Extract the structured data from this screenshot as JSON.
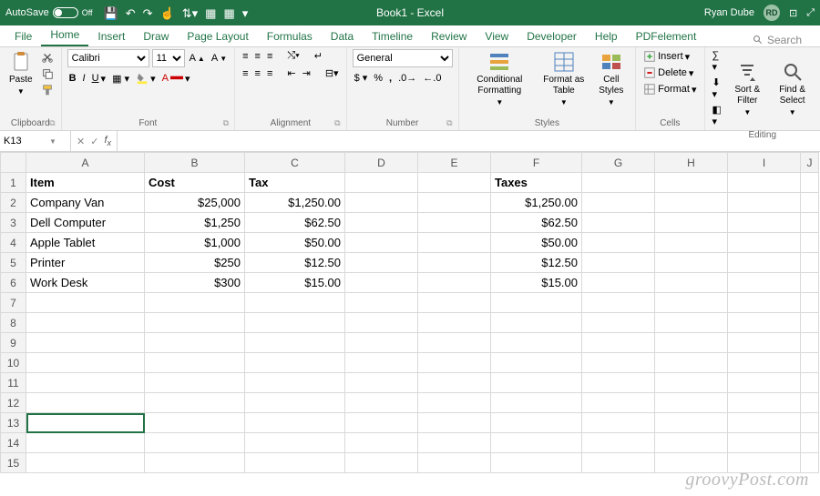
{
  "titlebar": {
    "autosave_label": "AutoSave",
    "autosave_state": "Off",
    "title": "Book1  -  Excel",
    "username": "Ryan Dube",
    "avatar_initials": "RD"
  },
  "tabs": {
    "file": "File",
    "items": [
      "Home",
      "Insert",
      "Draw",
      "Page Layout",
      "Formulas",
      "Data",
      "Timeline",
      "Review",
      "View",
      "Developer",
      "Help",
      "PDFelement"
    ],
    "active_index": 0,
    "search_placeholder": "Search"
  },
  "ribbon": {
    "clipboard": {
      "label": "Clipboard",
      "paste": "Paste"
    },
    "font": {
      "label": "Font",
      "name": "Calibri",
      "size": "11"
    },
    "alignment": {
      "label": "Alignment"
    },
    "number": {
      "label": "Number",
      "format": "General"
    },
    "styles": {
      "label": "Styles",
      "cond": "Conditional Formatting",
      "table": "Format as Table",
      "cell": "Cell Styles"
    },
    "cells": {
      "label": "Cells",
      "insert": "Insert",
      "delete": "Delete",
      "format": "Format"
    },
    "editing": {
      "label": "Editing",
      "sort": "Sort & Filter",
      "find": "Find & Select"
    }
  },
  "fbar": {
    "cell_ref": "K13",
    "formula": ""
  },
  "columns": [
    "A",
    "B",
    "C",
    "D",
    "E",
    "F",
    "G",
    "H",
    "I",
    "J"
  ],
  "rows": [
    {
      "n": "1",
      "A": "Item",
      "B": "Cost",
      "C": "Tax",
      "F": "Taxes",
      "bold": true
    },
    {
      "n": "2",
      "A": "Company Van",
      "B": "$25,000",
      "C": "$1,250.00",
      "F": "$1,250.00"
    },
    {
      "n": "3",
      "A": "Dell Computer",
      "B": "$1,250",
      "C": "$62.50",
      "F": "$62.50"
    },
    {
      "n": "4",
      "A": "Apple Tablet",
      "B": "$1,000",
      "C": "$50.00",
      "F": "$50.00"
    },
    {
      "n": "5",
      "A": "Printer",
      "B": "$250",
      "C": "$12.50",
      "F": "$12.50"
    },
    {
      "n": "6",
      "A": "Work Desk",
      "B": "$300",
      "C": "$15.00",
      "F": "$15.00"
    },
    {
      "n": "7"
    },
    {
      "n": "8"
    },
    {
      "n": "9"
    },
    {
      "n": "10"
    },
    {
      "n": "11"
    },
    {
      "n": "12"
    },
    {
      "n": "13",
      "sel": true
    },
    {
      "n": "14"
    },
    {
      "n": "15"
    }
  ],
  "watermark": "groovyPost.com"
}
